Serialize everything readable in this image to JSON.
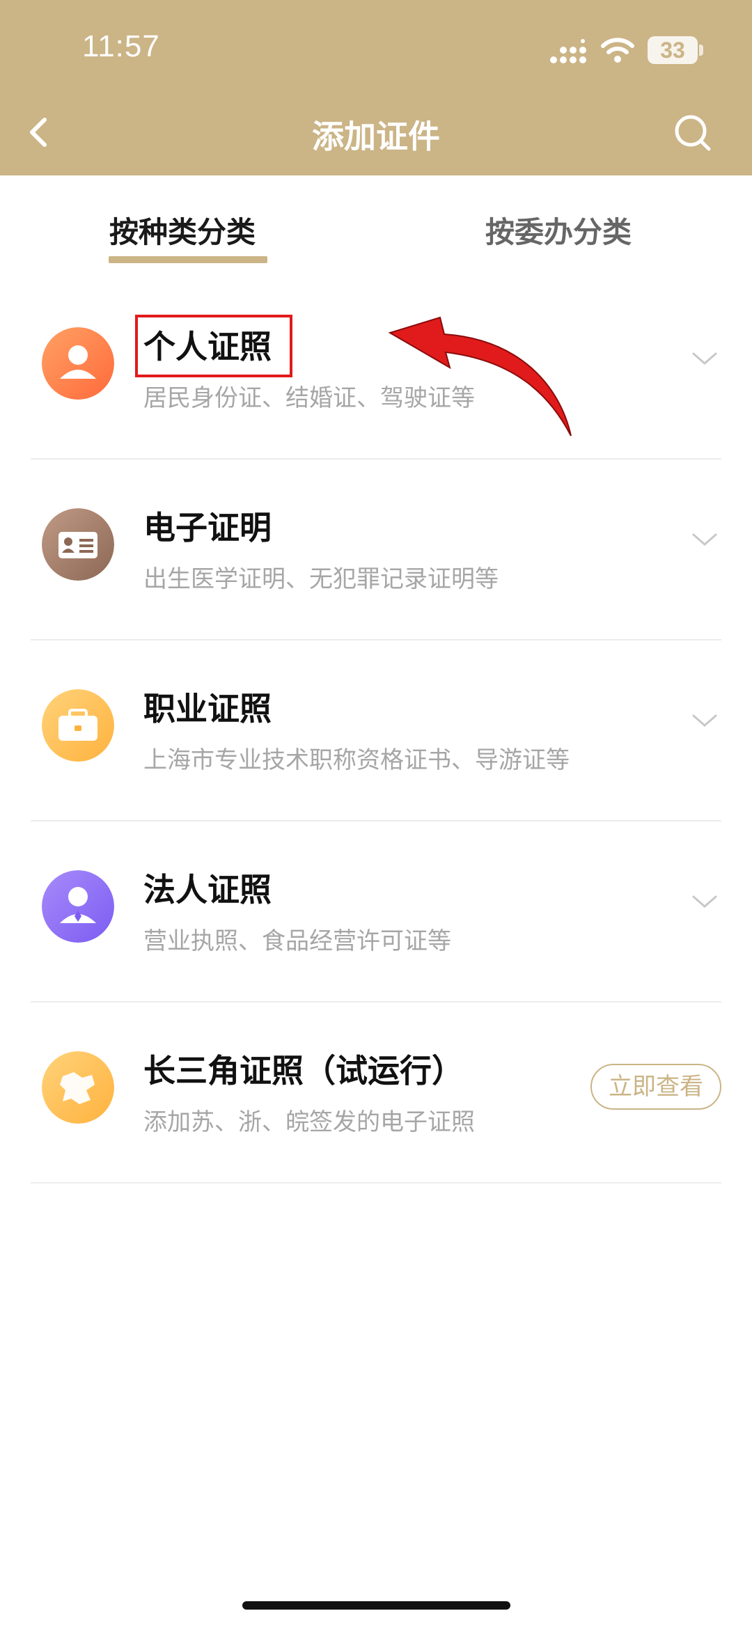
{
  "status_bar": {
    "time": "11:57",
    "battery": "33"
  },
  "nav": {
    "title": "添加证件"
  },
  "tabs": [
    {
      "label": "按种类分类",
      "active": true
    },
    {
      "label": "按委办分类",
      "active": false
    }
  ],
  "items": [
    {
      "title": "个人证照",
      "subtitle": "居民身份证、结婚证、驾驶证等",
      "icon": "person-icon"
    },
    {
      "title": "电子证明",
      "subtitle": "出生医学证明、无犯罪记录证明等",
      "icon": "id-card-icon"
    },
    {
      "title": "职业证照",
      "subtitle": "上海市专业技术职称资格证书、导游证等",
      "icon": "briefcase-icon"
    },
    {
      "title": "法人证照",
      "subtitle": "营业执照、食品经营许可证等",
      "icon": "business-person-icon"
    },
    {
      "title": "长三角证照（试运行）",
      "subtitle": "添加苏、浙、皖签发的电子证照",
      "icon": "region-map-icon",
      "action": "立即查看"
    }
  ],
  "colors": {
    "header": "#cbb486",
    "accent": "#cbb486",
    "annotation": "#e11b1b"
  }
}
